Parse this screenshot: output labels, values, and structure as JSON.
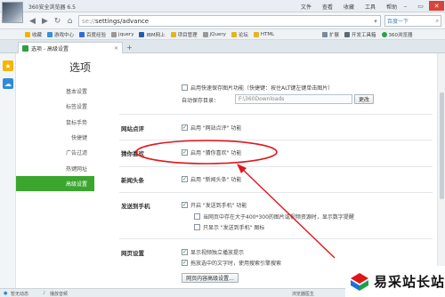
{
  "window": {
    "app_title": "360安全浏览器 6.5",
    "menu": [
      "文件",
      "查看",
      "收藏",
      "工具",
      "帮助"
    ]
  },
  "address": {
    "url_prefix": "se://",
    "url_path": "settings/advance",
    "search_placeholder": "百度一下"
  },
  "bookmarks": {
    "items": [
      "收藏",
      "游戏中心",
      "百度经验",
      "jquery",
      "IBM网上",
      "项目管理",
      "jQuery",
      "论坛",
      "HTML"
    ],
    "right_items": [
      "扩展",
      "开发工具箱",
      "360浏览器"
    ]
  },
  "tab": {
    "label": "选项 - 高级设置"
  },
  "settings": {
    "title": "选项",
    "nav": [
      "基本设置",
      "标签设置",
      "鼠标手势",
      "快捷键",
      "广告过滤",
      "热键网址",
      "高级设置"
    ],
    "active_nav": "高级设置"
  },
  "main": {
    "quick_save": {
      "label": "启用快速保存图片功能（快捷键：按住ALT键左键单击图片）",
      "dir_label": "自动保存目录：",
      "dir_value": "F:\\360Downloads",
      "change_button": "更改"
    },
    "site_review": {
      "section": "网站点评",
      "checkbox": "启用 \"网站点评\" 功能",
      "checked": true
    },
    "guess_like": {
      "section": "猜你喜欢",
      "checkbox": "启用 \"猜你喜欢\" 功能",
      "checked": true
    },
    "news": {
      "section": "新闻头条",
      "checkbox": "启用 \"新闻头条\" 功能",
      "checked": true
    },
    "send_phone": {
      "section": "发送到手机",
      "main": "开启 \"发送到手机\" 功能",
      "sub1": "当网页中存在大于400*300的图片或视频资源时，显示数字提醒",
      "sub2": "只显示 \"发送到手机\" 图标"
    },
    "page_settings": {
      "section": "网页设置",
      "opt1": "显示视频独立播放提示",
      "opt2": "拖放选中的文字时，使用搜索引擎搜索",
      "button": "网页内容高级设置..."
    }
  },
  "status": {
    "left": "暂无动态",
    "media": "播放音频",
    "right": "浏览器医生"
  },
  "watermark": {
    "text": "易采站长站"
  },
  "colors": {
    "accent": "#3aa62d",
    "annotation": "#e0161b"
  }
}
